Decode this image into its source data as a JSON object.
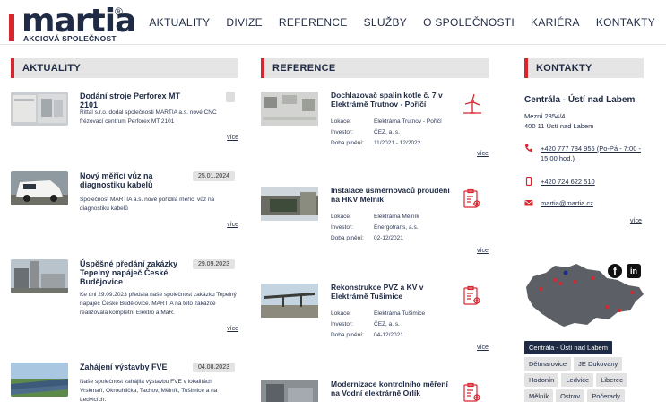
{
  "brand": {
    "name": "martia",
    "reg": "®",
    "tagline": "AKCIOVÁ SPOLEČNOST",
    "accent": "#d7262e",
    "navy": "#1f2a44"
  },
  "nav": [
    "AKTUALITY",
    "DIVIZE",
    "REFERENCE",
    "SLUŽBY",
    "O SPOLEČNOSTI",
    "KARIÉRA",
    "KONTAKTY"
  ],
  "sections": {
    "news": "AKTUALITY",
    "refs": "REFERENCE",
    "contacts": "KONTAKTY"
  },
  "more_label": "více",
  "news": [
    {
      "title": "Dodání stroje Perforex MT 2101",
      "date": "",
      "text": "Rittal s.r.o. dodal společnosti MARTIA a.s. nové CNC frézovací centrum Perforex MT 2101"
    },
    {
      "title": "Nový měřící vůz na diagnostiku kabelů",
      "date": "25.01.2024",
      "text": "Společnost MARTIA a.s. nově pořídila měřící vůz na diagnostiku kabelů"
    },
    {
      "title": "Úspěšné předání zakázky Tepelný napáječ České Budějovice",
      "date": "29.09.2023",
      "text": "Ke dni 29.09.2023 předala naše společnost zakázku Tepelný napáječ České Budějovice. MARTIA na této zakázce realizovala kompletní Elektro a MaR."
    },
    {
      "title": "Zahájení výstavby FVE",
      "date": "04.08.2023",
      "text": "Naše společnost zahájila výstavbu FVE v lokalitách Vrskmaň, Okrouhlička, Tachov, Mělník, Tušimice a na Ledvicích."
    }
  ],
  "ref_labels": {
    "lokace": "Lokace:",
    "investor": "Investor:",
    "doba": "Doba plnění:"
  },
  "refs": [
    {
      "title": "Dochlazovač spalin kotle č. 7 v Elektrárně Trutnov - Poříčí",
      "icon": "wind-turbine-icon",
      "lokace": "Elektrárna Trutnov - Poříčí",
      "investor": "ČEZ, a. s.",
      "doba": "11/2021 - 12/2022"
    },
    {
      "title": "Instalace usměrňovačů proudění na HKV Mělník",
      "icon": "clipboard-gear-icon",
      "lokace": "Elektrárna Mělník",
      "investor": "Energotrans, a.s.",
      "doba": "02-12/2021"
    },
    {
      "title": "Rekonstrukce PVZ a KV v Elektrárně Tušimice",
      "icon": "clipboard-gear-icon",
      "lokace": "Elektrárna Tušimice",
      "investor": "ČEZ, a. s.",
      "doba": "04-12/2021"
    },
    {
      "title": "Modernizace kontrolního měření na Vodní elektrárně Orlík",
      "icon": "clipboard-gear-icon"
    }
  ],
  "contact": {
    "title": "Centrála - Ústí nad Labem",
    "address1": "Mezní 2854/4",
    "address2": "400 11 Ústí nad Labem",
    "phone1": "+420 777 784 955 (Po-Pá - 7:00 - 15:00 hod.)",
    "phone2": "+420 724 622 510",
    "email": "martia@martia.cz"
  },
  "tags": [
    "Centrála - Ústí nad Labem",
    "Dětmarovice",
    "JE Dukovany",
    "Hodonín",
    "Ledvice",
    "Liberec",
    "Mělník",
    "Ostrov",
    "Počerady"
  ],
  "social": {
    "fb": "f",
    "li": "in"
  }
}
